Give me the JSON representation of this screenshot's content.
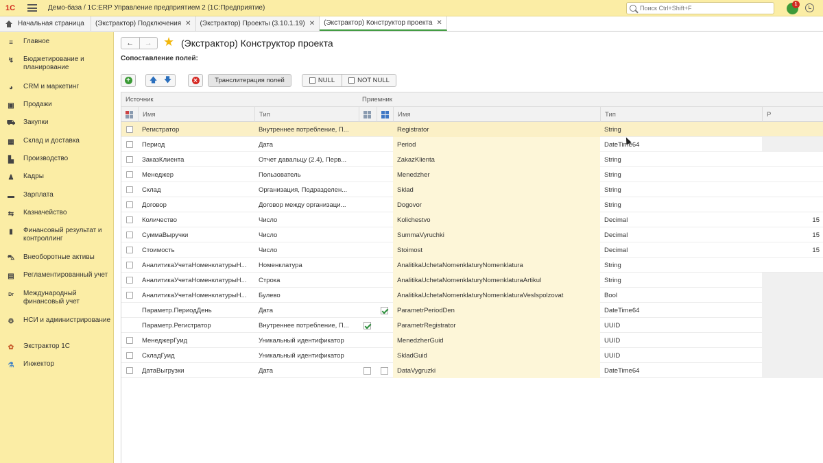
{
  "app": {
    "logo": "1С",
    "title": "Демо-база / 1С:ERP Управление предприятием 2  (1С:Предприятие)",
    "search_placeholder": "Поиск Ctrl+Shift+F",
    "notification_count": "1"
  },
  "tabs": [
    {
      "label": "Начальная страница"
    },
    {
      "label": "(Экстрактор) Подключения"
    },
    {
      "label": "(Экстрактор) Проекты (3.10.1.19)"
    },
    {
      "label": "(Экстрактор) Конструктор проекта"
    }
  ],
  "sidebar": {
    "items": [
      {
        "label": "Главное",
        "icon": "menu-icon"
      },
      {
        "label": "Бюджетирование и планирование",
        "icon": "budget-icon"
      },
      {
        "label": "CRM и маркетинг",
        "icon": "crm-icon"
      },
      {
        "label": "Продажи",
        "icon": "sales-icon"
      },
      {
        "label": "Закупки",
        "icon": "purchases-icon"
      },
      {
        "label": "Склад и доставка",
        "icon": "warehouse-icon"
      },
      {
        "label": "Производство",
        "icon": "production-icon"
      },
      {
        "label": "Кадры",
        "icon": "hr-icon"
      },
      {
        "label": "Зарплата",
        "icon": "salary-icon"
      },
      {
        "label": "Казначейство",
        "icon": "treasury-icon"
      },
      {
        "label": "Финансовый результат и контроллинг",
        "icon": "finance-icon"
      },
      {
        "label": "Внеоборотные активы",
        "icon": "assets-icon"
      },
      {
        "label": "Регламентированный учет",
        "icon": "accounting-icon"
      },
      {
        "label": "Международный финансовый учет",
        "icon": "ifrs-icon"
      },
      {
        "label": "НСИ и администрирование",
        "icon": "gear-icon"
      },
      {
        "label": "Экстрактор 1С",
        "icon": "extractor-icon"
      },
      {
        "label": "Инжектор",
        "icon": "injector-icon"
      }
    ]
  },
  "page": {
    "title": "(Экстрактор) Конструктор проекта",
    "section_label": "Сопоставление полей:",
    "translit_label": "Транслитерация полей",
    "null_label": "NULL",
    "not_null_label": "NOT NULL"
  },
  "table": {
    "group_source": "Источник",
    "group_target": "Приемник",
    "col_name": "Имя",
    "col_type": "Тип",
    "col_name2": "Имя",
    "col_type2": "Тип",
    "col_p": "Р",
    "rows": [
      {
        "src_name": "Регистратор",
        "src_type": "Внутреннее потребление, П...",
        "dst_name": "Registrator",
        "dst_type": "String",
        "p": "",
        "cb": "box",
        "c1": "",
        "c2": "",
        "sel": true,
        "gray": false
      },
      {
        "src_name": "Период",
        "src_type": "Дата",
        "dst_name": "Period",
        "dst_type": "DateTime64",
        "p": "",
        "cb": "box",
        "c1": "",
        "c2": "",
        "sel": false,
        "gray": true
      },
      {
        "src_name": "ЗаказКлиента",
        "src_type": "Отчет давальцу (2.4), Перв...",
        "dst_name": "ZakazKlienta",
        "dst_type": "String",
        "p": "",
        "cb": "box",
        "c1": "",
        "c2": "",
        "sel": false,
        "gray": false
      },
      {
        "src_name": "Менеджер",
        "src_type": "Пользователь",
        "dst_name": "Menedzher",
        "dst_type": "String",
        "p": "",
        "cb": "box",
        "c1": "",
        "c2": "",
        "sel": false,
        "gray": false
      },
      {
        "src_name": "Склад",
        "src_type": "Организация, Подразделен...",
        "dst_name": "Sklad",
        "dst_type": "String",
        "p": "",
        "cb": "box",
        "c1": "",
        "c2": "",
        "sel": false,
        "gray": false
      },
      {
        "src_name": "Договор",
        "src_type": "Договор между организаци...",
        "dst_name": "Dogovor",
        "dst_type": "String",
        "p": "",
        "cb": "box",
        "c1": "",
        "c2": "",
        "sel": false,
        "gray": false
      },
      {
        "src_name": "Количество",
        "src_type": "Число",
        "dst_name": "Kolichestvo",
        "dst_type": "Decimal",
        "p": "15",
        "cb": "box",
        "c1": "",
        "c2": "",
        "sel": false,
        "gray": false
      },
      {
        "src_name": "СуммаВыручки",
        "src_type": "Число",
        "dst_name": "SummaVyruchki",
        "dst_type": "Decimal",
        "p": "15",
        "cb": "box",
        "c1": "",
        "c2": "",
        "sel": false,
        "gray": false
      },
      {
        "src_name": "Стоимость",
        "src_type": "Число",
        "dst_name": "Stoimost",
        "dst_type": "Decimal",
        "p": "15",
        "cb": "box",
        "c1": "",
        "c2": "",
        "sel": false,
        "gray": false
      },
      {
        "src_name": "АналитикаУчетаНоменклатурыН...",
        "src_type": "Номенклатура",
        "dst_name": "AnalitikaUchetaNomenklaturyNomenklatura",
        "dst_type": "String",
        "p": "",
        "cb": "box",
        "c1": "",
        "c2": "",
        "sel": false,
        "gray": false
      },
      {
        "src_name": "АналитикаУчетаНоменклатурыН...",
        "src_type": "Строка",
        "dst_name": "AnalitikaUchetaNomenklaturyNomenklaturaArtikul",
        "dst_type": "String",
        "p": "",
        "cb": "box",
        "c1": "",
        "c2": "",
        "sel": false,
        "gray": true
      },
      {
        "src_name": "АналитикаУчетаНоменклатурыН...",
        "src_type": "Булево",
        "dst_name": "AnalitikaUchetaNomenklaturyNomenklaturaVesIspolzovat",
        "dst_type": "Bool",
        "p": "",
        "cb": "box",
        "c1": "",
        "c2": "",
        "sel": false,
        "gray": true
      },
      {
        "src_name": "Параметр.ПериодДень",
        "src_type": "Дата",
        "dst_name": "ParametrPeriodDen",
        "dst_type": "DateTime64",
        "p": "",
        "cb": "none",
        "c1": "",
        "c2": "checked",
        "sel": false,
        "gray": true
      },
      {
        "src_name": "Параметр.Регистратор",
        "src_type": "Внутреннее потребление, П...",
        "dst_name": "ParametrRegistrator",
        "dst_type": "UUID",
        "p": "",
        "cb": "none",
        "c1": "checked",
        "c2": "",
        "sel": false,
        "gray": true
      },
      {
        "src_name": "МенеджерГуид",
        "src_type": "Уникальный идентификатор",
        "dst_name": "MenedzherGuid",
        "dst_type": "UUID",
        "p": "",
        "cb": "box",
        "c1": "",
        "c2": "",
        "sel": false,
        "gray": true
      },
      {
        "src_name": "СкладГуид",
        "src_type": "Уникальный идентификатор",
        "dst_name": "SkladGuid",
        "dst_type": "UUID",
        "p": "",
        "cb": "box",
        "c1": "",
        "c2": "",
        "sel": false,
        "gray": true
      },
      {
        "src_name": "ДатаВыгрузки",
        "src_type": "Дата",
        "dst_name": "DataVygruzki",
        "dst_type": "DateTime64",
        "p": "",
        "cb": "box",
        "c1": "empty",
        "c2": "empty",
        "sel": false,
        "gray": true
      }
    ]
  },
  "colors": {
    "sidebar_bg": "#fbeda5",
    "accent_green": "#3a9a35",
    "selected_row": "#fbf0c6",
    "star": "#f2b70d"
  }
}
